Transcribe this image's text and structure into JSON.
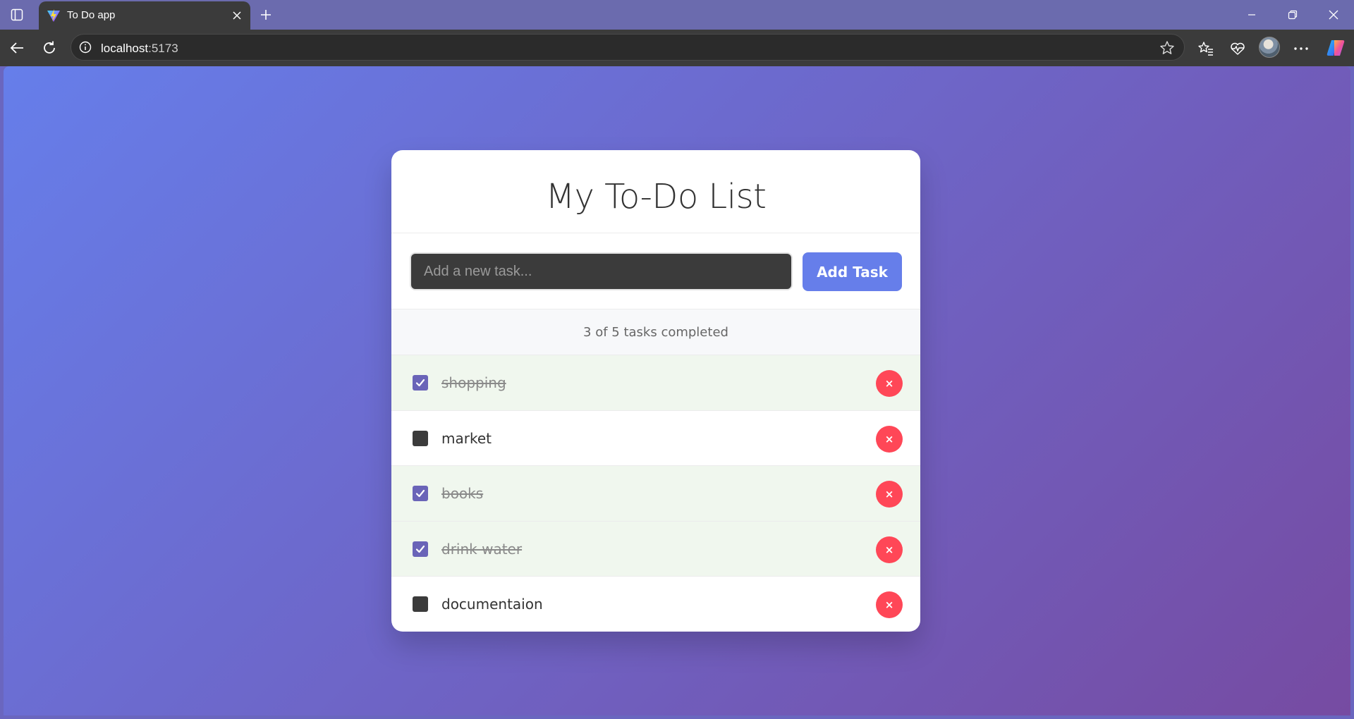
{
  "browser": {
    "tab_title": "To Do app",
    "url_host": "localhost",
    "url_port": ":5173"
  },
  "app": {
    "title": "My To-Do List",
    "input_placeholder": "Add a new task...",
    "input_value": "",
    "add_button_label": "Add Task",
    "stats_text": "3 of 5 tasks completed",
    "delete_label": "×",
    "tasks": [
      {
        "text": "shopping",
        "completed": true
      },
      {
        "text": "market",
        "completed": false
      },
      {
        "text": "books",
        "completed": true
      },
      {
        "text": "drink water",
        "completed": true
      },
      {
        "text": "documentaion",
        "completed": false
      }
    ]
  },
  "colors": {
    "gradient_start": "#667eea",
    "gradient_end": "#764ba2",
    "accent": "#667eea",
    "delete": "#ff4757",
    "completed_row": "#f0f7ee"
  },
  "icons": {
    "sidebar_toggle": "tab-sidebar-icon",
    "tab_favicon": "vite-logo-icon",
    "tab_close": "close-icon",
    "new_tab": "plus-icon",
    "minimize": "minimize-icon",
    "restore": "restore-icon",
    "window_close": "close-icon",
    "back": "back-arrow-icon",
    "refresh": "refresh-icon",
    "site_info": "info-icon",
    "favorite": "star-icon",
    "favorites": "favorites-icon",
    "health": "heartbeat-icon",
    "more": "more-icon",
    "copilot": "copilot-icon",
    "check": "checkmark-icon"
  }
}
